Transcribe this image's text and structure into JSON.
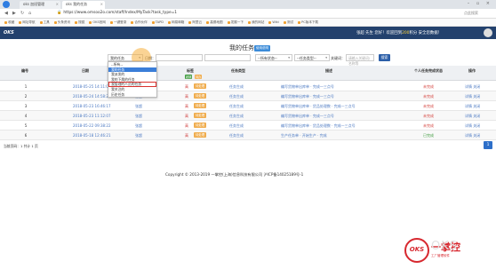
{
  "browser": {
    "tab1": "oks 加班管理",
    "tab2": "oks 我的任务",
    "url": "https://www.omsoo2o.com/staff/Index/MyTask?task_type=1",
    "addr_hint": "点此搜索",
    "bookmarks": [
      "收藏",
      "网址导航",
      "工具",
      "头条资讯",
      "搜狐",
      "OKS官网",
      "一键登录",
      "合作伙伴",
      "TAPD",
      "网易邮箱",
      "阿里云",
      "高德地图",
      "发展一下",
      "我的网站",
      "Wiki",
      "测试",
      "PC版本下载"
    ]
  },
  "header": {
    "brand": "OKS",
    "welcome": "张超 先生 您好！欢迎回到",
    "points": "200",
    "welcome_tail": "积分 安全您数据！"
  },
  "page": {
    "title": "我的任务",
    "help_badge": "使用说明"
  },
  "filters": {
    "task_select": "我的任务",
    "date_label": "日期：",
    "sel2": "--所有状态--",
    "sel3": "--任务类型--",
    "keyword_label": "关键词：",
    "keyword_placeholder": "请输入关键词/名称等",
    "search_button": "搜索"
  },
  "dropdown": {
    "items": [
      "--所有--",
      "我的任务",
      "我派发的",
      "我的下属的任务",
      "我管理的人员的任务",
      "我关注的",
      "历史任务"
    ],
    "selected_index": 1,
    "boxed_index": 4
  },
  "table": {
    "headers": [
      "编号",
      "日期",
      "下派人",
      "标签",
      "任务类型",
      "描述",
      "个人任务完成状态",
      "操作"
    ],
    "header_tags": [
      "超期",
      "待办"
    ],
    "rows": [
      {
        "no": "1",
        "date": "2018-05-25 14:11:00",
        "person": "张超",
        "flag": "高",
        "tag": "待处理",
        "type": "任务生成",
        "desc": "编写货物单出库单 · 完成一三点号",
        "status": "未完成",
        "status_color": "#d43f3a",
        "ops": "详情 关闭"
      },
      {
        "no": "2",
        "date": "2018-05-24 14:58:25",
        "person": "张超",
        "flag": "高",
        "tag": "待处理",
        "type": "任务生成",
        "desc": "编写货物单出库单 · 完成一三点号",
        "status": "未完成",
        "status_color": "#d43f3a",
        "ops": "详情 关闭"
      },
      {
        "no": "3",
        "date": "2018-05-23 16:46:17",
        "person": "张超",
        "flag": "高",
        "tag": "待处理",
        "type": "任务生成",
        "desc": "编写货物单出库单 · 货品处理数 · 完成一三点号",
        "status": "未完成",
        "status_color": "#d43f3a",
        "ops": "详情 关闭"
      },
      {
        "no": "4",
        "date": "2018-05-23 11:12:07",
        "person": "张超",
        "flag": "高",
        "tag": "待处理",
        "type": "任务生成",
        "desc": "编写货物单出库单 · 完成一三点号",
        "status": "未完成",
        "status_color": "#d43f3a",
        "ops": "详情 关闭"
      },
      {
        "no": "5",
        "date": "2018-05-22 09:38:22",
        "person": "张超",
        "flag": "高",
        "tag": "待处理",
        "type": "任务生成",
        "desc": "编写货物单出库单 · 货品处理数 · 完成一三点号",
        "status": "未完成",
        "status_color": "#d43f3a",
        "ops": "详情 关闭"
      },
      {
        "no": "6",
        "date": "2018-05-18 12:46:21",
        "person": "张超",
        "flag": "高",
        "tag": "待处理",
        "type": "任务生成",
        "desc": "生产任务单 · 开始生产 · 完成",
        "status": "已完成",
        "status_color": "#3c9a3c",
        "ops": "详情 关闭"
      }
    ]
  },
  "footer": {
    "summary": "当前页码：1   共计 1 页",
    "page": "1",
    "copyright": "Copyright © 2013-2019 一掌控(上海)信息科技有限公司 沪ICP备14025189号-1"
  },
  "watermark": {
    "brand": "OKS",
    "name": "一掌控",
    "sub": "工厂管理软件",
    "faint": "OKS"
  }
}
